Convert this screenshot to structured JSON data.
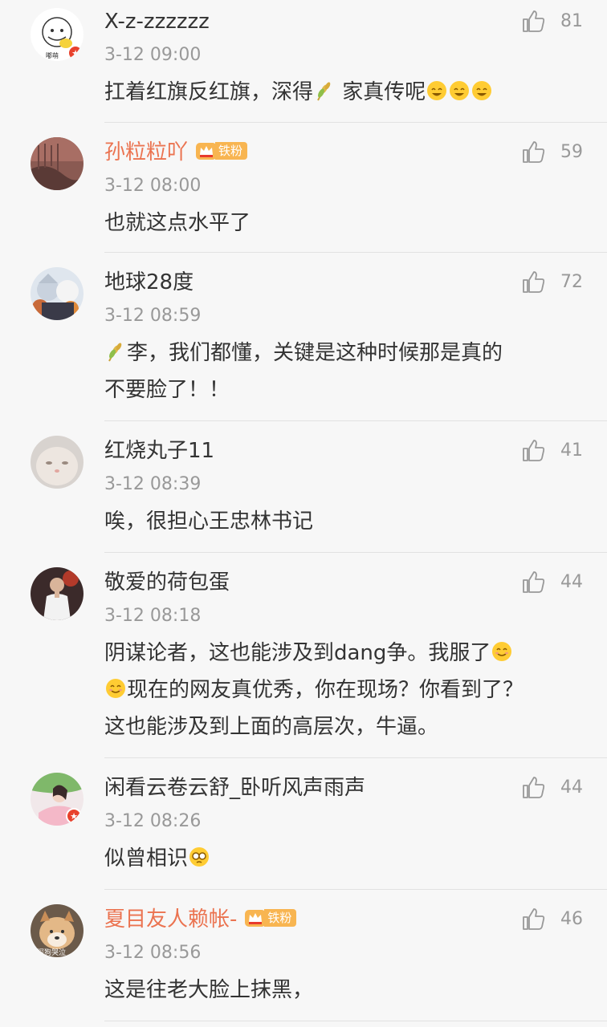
{
  "comments": [
    {
      "name": "X-z-zzzzzz",
      "time": "3-12 09:00",
      "likes": "81",
      "text_parts": [
        "扛着红旗反红旗，深得",
        " 家真传呢"
      ],
      "avatar_label": "嘟萌"
    },
    {
      "name": "孙粒粒吖",
      "time": "3-12 08:00",
      "likes": "59",
      "fans": "铁粉",
      "text": "也就这点水平了"
    },
    {
      "name": "地球28度",
      "time": "3-12 08:59",
      "likes": "72",
      "text_parts": [
        "李，我们都懂，关键是这种时候那是真的",
        "不要脸了！！"
      ]
    },
    {
      "name": "红烧丸子11",
      "time": "3-12 08:39",
      "likes": "41",
      "text": "唉，很担心王忠林书记"
    },
    {
      "name": "敬爱的荷包蛋",
      "time": "3-12 08:18",
      "likes": "44",
      "text_parts": [
        "阴谋论者，这也能涉及到dang争。我服了",
        "现在的网友真优秀，你在现场？你看到了？",
        "这也能涉及到上面的高层次，牛逼。"
      ]
    },
    {
      "name": "闲看云卷云舒_卧听风声雨声",
      "time": "3-12 08:26",
      "likes": "44",
      "text": "似曾相识"
    },
    {
      "name": "夏目友人赖帐-",
      "time": "3-12 08:56",
      "likes": "46",
      "fans": "铁粉",
      "text": "这是往老大脸上抹黑，",
      "avatar_label": "探狗哭泣"
    }
  ],
  "icons": {
    "like": "thumbs-up-icon",
    "fans": "crown-icon"
  },
  "colors": {
    "vip_name": "#eb7350",
    "fans_badge": "#f8b551",
    "meta": "#999999",
    "divider": "#e2e2e2"
  }
}
